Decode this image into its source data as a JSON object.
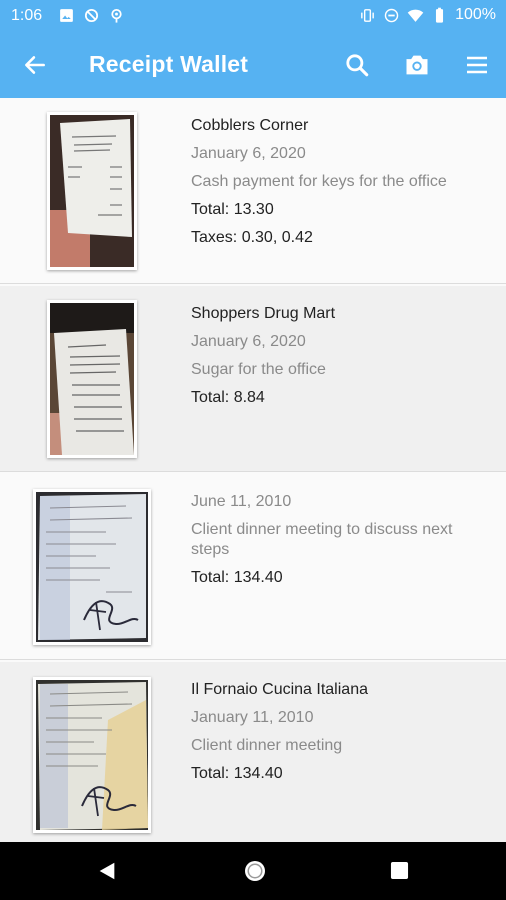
{
  "status_bar": {
    "time": "1:06",
    "battery_text": "100%",
    "left_icons": [
      "image-icon",
      "sync-off-icon",
      "location-icon"
    ],
    "right_icons": [
      "vibrate-icon",
      "do-not-disturb-icon",
      "wifi-icon",
      "battery-icon"
    ]
  },
  "app_bar": {
    "title": "Receipt Wallet",
    "icons": [
      "back-arrow-icon",
      "search-icon",
      "camera-icon",
      "menu-icon"
    ]
  },
  "receipts": [
    {
      "merchant": "Cobblers Corner",
      "date": "January 6, 2020",
      "description": "Cash payment for keys for the office",
      "total": "Total: 13.30",
      "taxes": "Taxes: 0.30, 0.42"
    },
    {
      "merchant": "Shoppers Drug Mart",
      "date": "January 6, 2020",
      "description": "Sugar for the office",
      "total": "Total: 8.84"
    },
    {
      "merchant": "",
      "date": "June 11, 2010",
      "description": "Client dinner meeting to discuss next steps",
      "total": "Total: 134.40"
    },
    {
      "merchant": "Il Fornaio Cucina Italiana",
      "date": "January 11, 2010",
      "description": "Client dinner meeting",
      "total": "Total: 134.40"
    }
  ],
  "nav_bar": {
    "icons": [
      "nav-back-icon",
      "nav-home-icon",
      "nav-recents-icon"
    ]
  },
  "colors": {
    "accent": "#56b2f2",
    "row_alt": "#f0f0f0",
    "row": "#fafafa"
  }
}
